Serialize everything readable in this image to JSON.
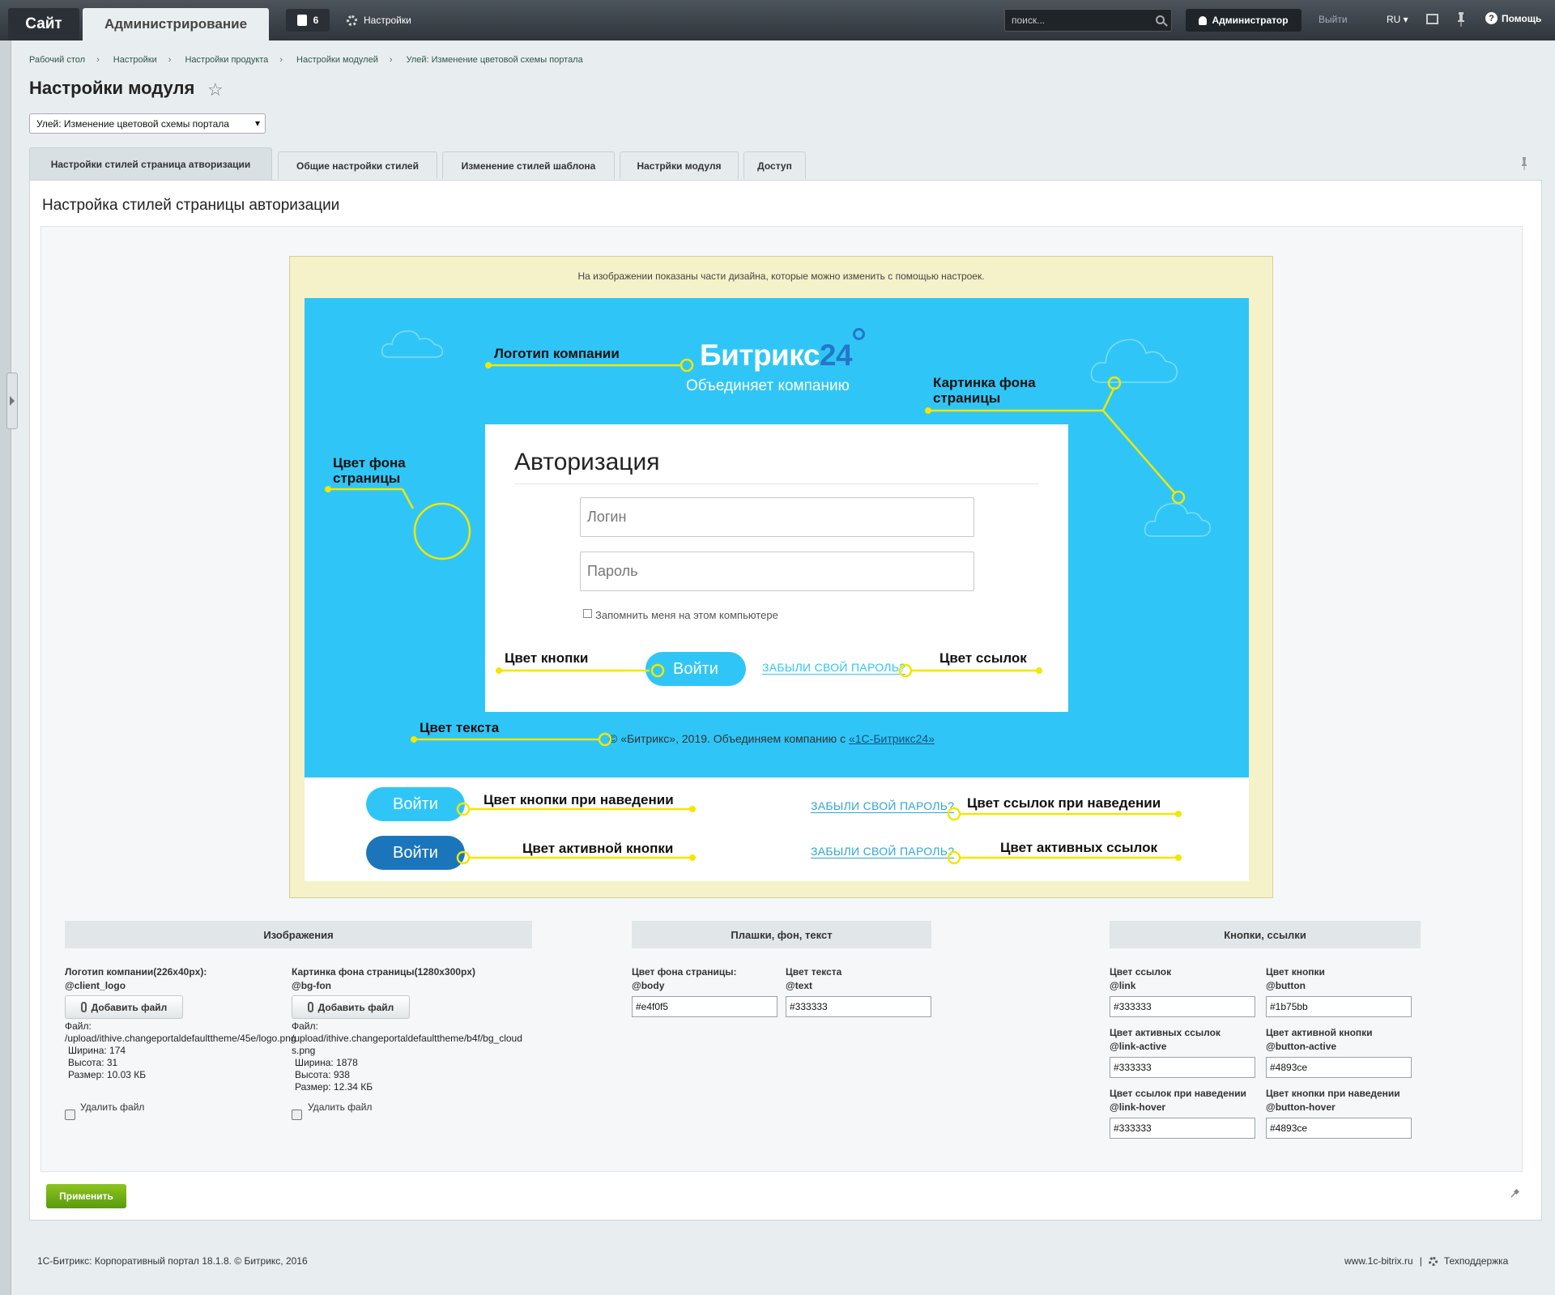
{
  "topbar": {
    "site_label": "Сайт",
    "admin_label": "Администрирование",
    "notifications_count": "6",
    "settings_label": "Настройки",
    "search_placeholder": "поиск...",
    "user_label": "Администратор",
    "exit_label": "Выйти",
    "lang_label": "RU ▾",
    "help_label": "Помощь"
  },
  "breadcrumbs": [
    "Рабочий стол",
    "Настройки",
    "Настройки продукта",
    "Настройки модулей",
    "Улей: Изменение цветовой схемы портала"
  ],
  "page_title": "Настройки модуля",
  "module_select": "Улей: Изменение цветовой схемы портала",
  "tabs": [
    "Настройки стилей страница атворизации",
    "Общие настройки стилей",
    "Изменение стилей шаблона",
    "Настрйки модуля",
    "Доступ"
  ],
  "panel_title": "Настройка стилей страницы авторизации",
  "preview": {
    "note": "На изображении показаны части дизайна, которые можно изменить с помощью настроек.",
    "logo_main": "Битрикс",
    "logo_num": "24",
    "slogan": "Объединяет компанию",
    "auth_title": "Авторизация",
    "login_placeholder": "Логин",
    "password_placeholder": "Пароль",
    "remember": "Запомнить меня на этом компьютере",
    "login_button": "Войти",
    "forgot_link": "ЗАБЫЛИ СВОЙ ПАРОЛЬ?",
    "copyright_prefix": "© «Битрикс», 2019. Объединяем компанию с ",
    "copyright_link": "«1С-Битрикс24»",
    "labels": {
      "logo": "Логотип компании",
      "bg_image_1": "Картинка фона",
      "bg_image_2": "страницы",
      "bg_color_1": "Цвет фона",
      "bg_color_2": "страницы",
      "button_color": "Цвет кнопки",
      "link_color": "Цвет ссылок",
      "text_color": "Цвет текста",
      "button_hover": "Цвет кнопки при наведении",
      "link_hover": "Цвет ссылок при наведении",
      "button_active": "Цвет активной кнопки",
      "link_active": "Цвет активных ссылок"
    },
    "colors": {
      "page_bg": "#2fc6f7",
      "accent_line": "#f3e600",
      "button": "#2fc6f7",
      "button_active": "#1b75bb",
      "logo_num": "#2576c8"
    }
  },
  "sections": {
    "images": "Изображения",
    "plates": "Плашки, фон, текст",
    "buttons": "Кнопки, ссылки"
  },
  "images": [
    {
      "label": "Логотип компании(226x40px):",
      "var": "@client_logo",
      "button": "Добавить файл",
      "file_label": "Файл:",
      "path": "/upload/ithive.changeportaldefaulttheme/45e/logo.png",
      "width": "Ширина: 174",
      "height": "Высота: 31",
      "size": "Размер: 10.03 КБ",
      "delete": "Удалить файл"
    },
    {
      "label": "Картинка фона страницы(1280x300px)",
      "var": "@bg-fon",
      "button": "Добавить файл",
      "file_label": "Файл:",
      "path": "/upload/ithive.changeportaldefaulttheme/b4f/bg_clouds.png",
      "width": "Ширина: 1878",
      "height": "Высота: 938",
      "size": "Размер: 12.34 КБ",
      "delete": "Удалить файл"
    }
  ],
  "plates": [
    {
      "label": "Цвет фона страницы:",
      "var": "@body",
      "value": "#e4f0f5"
    },
    {
      "label": "Цвет текста",
      "var": "@text",
      "value": "#333333"
    }
  ],
  "buttons": [
    {
      "label": "Цвет ссылок",
      "var": "@link",
      "value": "#333333"
    },
    {
      "label": "Цвет кнопки",
      "var": "@button",
      "value": "#1b75bb"
    },
    {
      "label": "Цвет активных ссылок",
      "var": "@link-active",
      "value": "#333333"
    },
    {
      "label": "Цвет активной кнопки",
      "var": "@button-active",
      "value": "#4893ce"
    },
    {
      "label": "Цвет ссылок при наведении",
      "var": "@link-hover",
      "value": "#333333"
    },
    {
      "label": "Цвет кнопки при наведении",
      "var": "@button-hover",
      "value": "#4893ce"
    }
  ],
  "apply_label": "Применить",
  "footer": {
    "left": "1С-Битрикс: Корпоративный портал 18.1.8. © Битрикс, 2016",
    "site": "www.1c-bitrix.ru",
    "sep": "|",
    "support": "Техподдержка"
  }
}
